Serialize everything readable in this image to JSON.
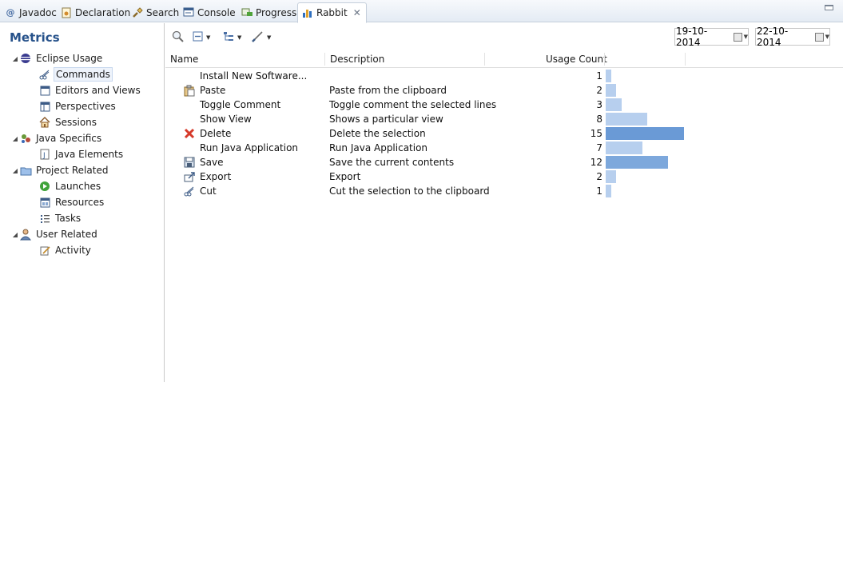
{
  "tabs": [
    {
      "label": "Javadoc",
      "icon": "at-icon"
    },
    {
      "label": "Declaration",
      "icon": "declaration-icon"
    },
    {
      "label": "Search",
      "icon": "search-flashlight-icon"
    },
    {
      "label": "Console",
      "icon": "console-icon"
    },
    {
      "label": "Progress",
      "icon": "progress-icon"
    },
    {
      "label": "Rabbit",
      "icon": "bar-chart-icon",
      "active": true
    }
  ],
  "sidebar": {
    "title": "Metrics",
    "groups": [
      {
        "label": "Eclipse Usage",
        "icon": "eclipse-icon",
        "items": [
          {
            "label": "Commands",
            "icon": "commands-icon",
            "selected": true
          },
          {
            "label": "Editors and Views",
            "icon": "window-icon"
          },
          {
            "label": "Perspectives",
            "icon": "perspective-icon"
          },
          {
            "label": "Sessions",
            "icon": "home-icon"
          }
        ]
      },
      {
        "label": "Java Specifics",
        "icon": "java-specifics-icon",
        "items": [
          {
            "label": "Java Elements",
            "icon": "java-file-icon"
          }
        ]
      },
      {
        "label": "Project Related",
        "icon": "folder-icon",
        "items": [
          {
            "label": "Launches",
            "icon": "launch-icon"
          },
          {
            "label": "Resources",
            "icon": "resources-icon"
          },
          {
            "label": "Tasks",
            "icon": "tasks-icon"
          }
        ]
      },
      {
        "label": "User Related",
        "icon": "user-icon",
        "items": [
          {
            "label": "Activity",
            "icon": "activity-icon"
          }
        ]
      }
    ]
  },
  "toolbar": {
    "start_date": "19-10-2014",
    "end_date": "22-10-2014"
  },
  "table": {
    "columns": [
      "Name",
      "Description",
      "Usage Count"
    ],
    "bar_colors": {
      "max": "#6a9ad6",
      "high": "#7da8dc",
      "low": "#b7cfee"
    },
    "rows": [
      {
        "name": "Install New Software...",
        "description": "",
        "count": 1,
        "icon": ""
      },
      {
        "name": "Paste",
        "description": "Paste from the clipboard",
        "count": 2,
        "icon": "paste-icon"
      },
      {
        "name": "Toggle Comment",
        "description": "Toggle comment the selected lines",
        "count": 3,
        "icon": ""
      },
      {
        "name": "Show View",
        "description": "Shows a particular view",
        "count": 8,
        "icon": ""
      },
      {
        "name": "Delete",
        "description": "Delete the selection",
        "count": 15,
        "icon": "delete-icon"
      },
      {
        "name": "Run Java Application",
        "description": "Run Java Application",
        "count": 7,
        "icon": ""
      },
      {
        "name": "Save",
        "description": "Save the current contents",
        "count": 12,
        "icon": "save-icon"
      },
      {
        "name": "Export",
        "description": "Export",
        "count": 2,
        "icon": "export-icon"
      },
      {
        "name": "Cut",
        "description": "Cut the selection to the clipboard",
        "count": 1,
        "icon": "cut-icon"
      }
    ]
  }
}
